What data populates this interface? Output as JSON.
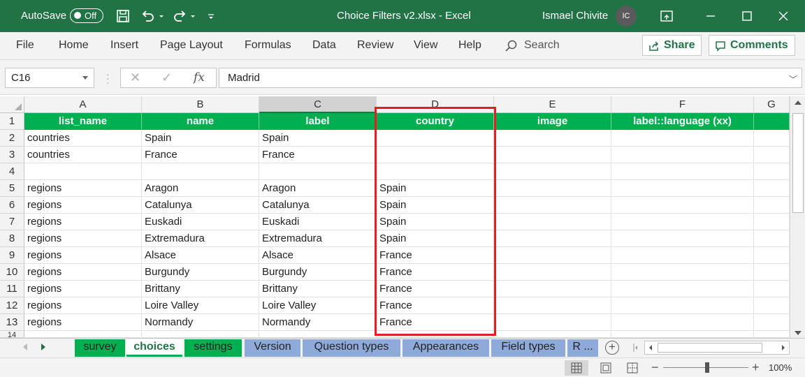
{
  "titlebar": {
    "autosave_label": "AutoSave",
    "autosave_state": "Off",
    "document_title": "Choice Filters v2.xlsx - Excel",
    "user_name": "Ismael Chivite",
    "user_initials": "IC"
  },
  "ribbon": {
    "tabs": [
      "File",
      "Home",
      "Insert",
      "Page Layout",
      "Formulas",
      "Data",
      "Review",
      "View",
      "Help"
    ],
    "search_label": "Search",
    "share_label": "Share",
    "comments_label": "Comments"
  },
  "formula_bar": {
    "name_box": "C16",
    "fx_label": "fx",
    "content": "Madrid"
  },
  "sheet": {
    "columns": [
      "A",
      "B",
      "C",
      "D",
      "E",
      "F",
      "G"
    ],
    "selected_column": "C",
    "header_row": [
      "list_name",
      "name",
      "label",
      "country",
      "image",
      "label::language (xx)",
      ""
    ],
    "rows": [
      {
        "num": "1"
      },
      {
        "num": "2",
        "cells": [
          "countries",
          "Spain",
          "Spain",
          ""
        ]
      },
      {
        "num": "3",
        "cells": [
          "countries",
          "France",
          "France",
          ""
        ]
      },
      {
        "num": "4",
        "cells": [
          "",
          "",
          "",
          ""
        ]
      },
      {
        "num": "5",
        "cells": [
          "regions",
          "Aragon",
          "Aragon",
          "Spain"
        ]
      },
      {
        "num": "6",
        "cells": [
          "regions",
          "Catalunya",
          "Catalunya",
          "Spain"
        ]
      },
      {
        "num": "7",
        "cells": [
          "regions",
          "Euskadi",
          "Euskadi",
          "Spain"
        ]
      },
      {
        "num": "8",
        "cells": [
          "regions",
          "Extremadura",
          "Extremadura",
          "Spain"
        ]
      },
      {
        "num": "9",
        "cells": [
          "regions",
          "Alsace",
          "Alsace",
          "France"
        ]
      },
      {
        "num": "10",
        "cells": [
          "regions",
          "Burgundy",
          "Burgundy",
          "France"
        ]
      },
      {
        "num": "11",
        "cells": [
          "regions",
          "Brittany",
          "Brittany",
          "France"
        ]
      },
      {
        "num": "12",
        "cells": [
          "regions",
          "Loire Valley",
          "Loire Valley",
          "France"
        ]
      },
      {
        "num": "13",
        "cells": [
          "regions",
          "Normandy",
          "Normandy",
          "France"
        ]
      },
      {
        "num": "14"
      }
    ]
  },
  "sheet_tabs": [
    {
      "label": "survey",
      "style": "green"
    },
    {
      "label": "choices",
      "style": "active"
    },
    {
      "label": "settings",
      "style": "green"
    },
    {
      "label": "Version",
      "style": "blue"
    },
    {
      "label": "Question types",
      "style": "blue"
    },
    {
      "label": "Appearances",
      "style": "blue"
    },
    {
      "label": "Field types",
      "style": "blue"
    },
    {
      "label": "R ...",
      "style": "blue"
    }
  ],
  "status": {
    "zoom_minus": "−",
    "zoom_plus": "+",
    "zoom_level": "100%"
  },
  "colors": {
    "excel_green": "#217346",
    "header_fill": "#00b050",
    "blue_tab": "#8eaadb",
    "annotation_red": "#e41e26"
  }
}
